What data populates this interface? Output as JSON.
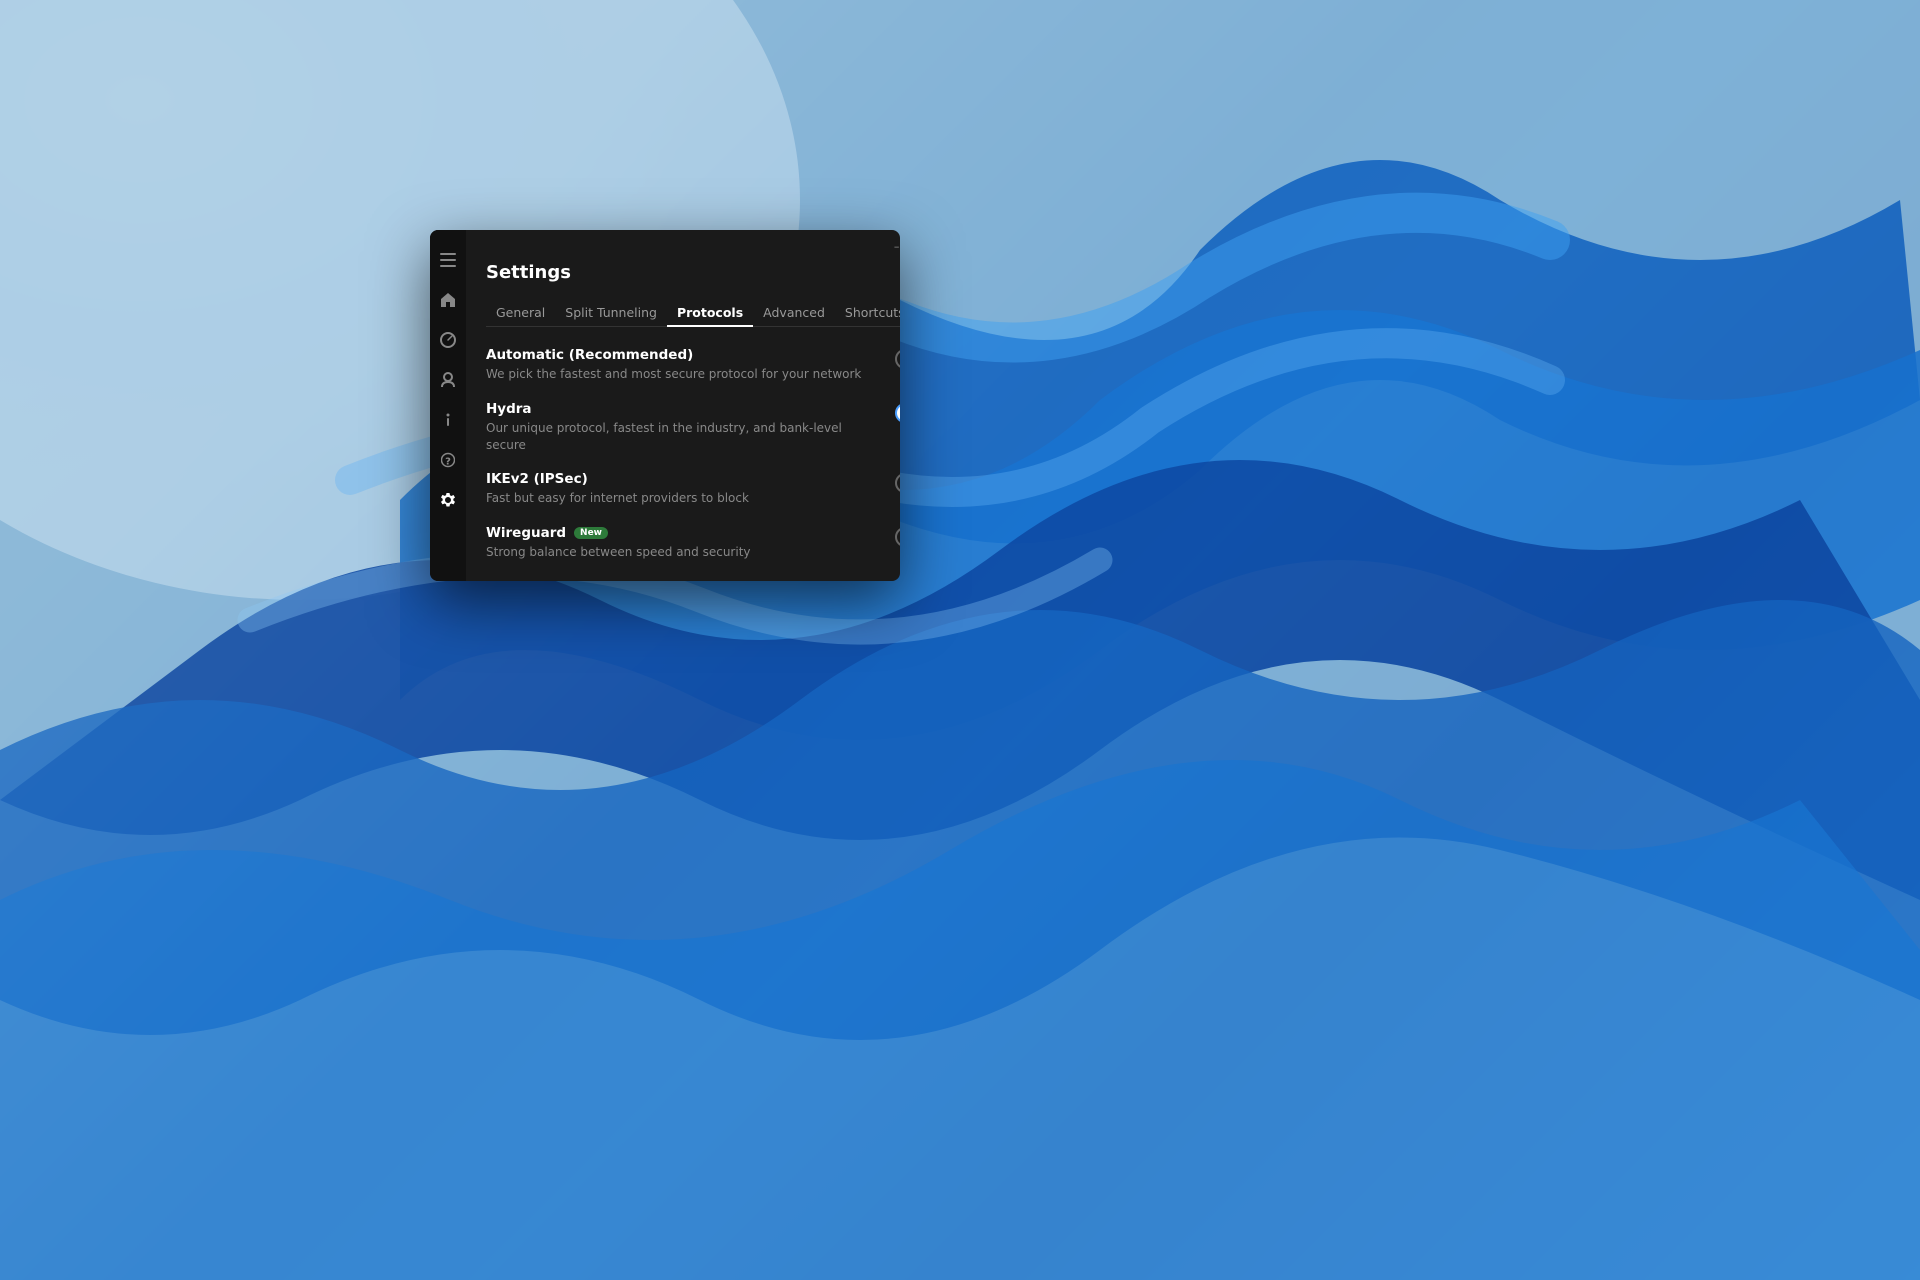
{
  "desktop": {
    "background_desc": "Windows 11 blue ribbon wallpaper"
  },
  "window": {
    "title": "Settings",
    "title_bar": {
      "minimize_label": "–",
      "close_label": "✕"
    },
    "tabs": [
      {
        "id": "general",
        "label": "General",
        "active": false
      },
      {
        "id": "split-tunneling",
        "label": "Split Tunneling",
        "active": false
      },
      {
        "id": "protocols",
        "label": "Protocols",
        "active": true
      },
      {
        "id": "advanced",
        "label": "Advanced",
        "active": false
      },
      {
        "id": "shortcuts",
        "label": "Shortcuts",
        "active": false
      }
    ],
    "protocols": [
      {
        "id": "automatic",
        "name": "Automatic (Recommended)",
        "description": "We pick the fastest and most secure protocol for your network",
        "selected": false,
        "badge": null
      },
      {
        "id": "hydra",
        "name": "Hydra",
        "description": "Our unique protocol, fastest in the industry, and bank-level secure",
        "selected": true,
        "badge": null
      },
      {
        "id": "ikev2",
        "name": "IKEv2 (IPSec)",
        "description": "Fast but easy for internet providers to block",
        "selected": false,
        "badge": null
      },
      {
        "id": "wireguard",
        "name": "Wireguard",
        "description": "Strong balance between speed and security",
        "selected": false,
        "badge": "New"
      }
    ],
    "sidebar": {
      "icons": [
        {
          "id": "menu",
          "symbol": "☰",
          "active": false
        },
        {
          "id": "home",
          "symbol": "⌂",
          "active": false
        },
        {
          "id": "speed",
          "symbol": "◔",
          "active": false
        },
        {
          "id": "profile",
          "symbol": "👤",
          "active": false
        },
        {
          "id": "info",
          "symbol": "ℹ",
          "active": false
        },
        {
          "id": "help",
          "symbol": "?",
          "active": false
        },
        {
          "id": "settings",
          "symbol": "⚙",
          "active": true
        }
      ]
    }
  },
  "colors": {
    "accent_blue": "#4a9eff",
    "new_badge_bg": "#2d7a3a",
    "sidebar_bg": "#111111",
    "window_bg": "#1a1a1a",
    "active_tab_color": "#ffffff",
    "inactive_tab_color": "#999999",
    "protocol_name_color": "#ffffff",
    "protocol_desc_color": "#888888"
  }
}
